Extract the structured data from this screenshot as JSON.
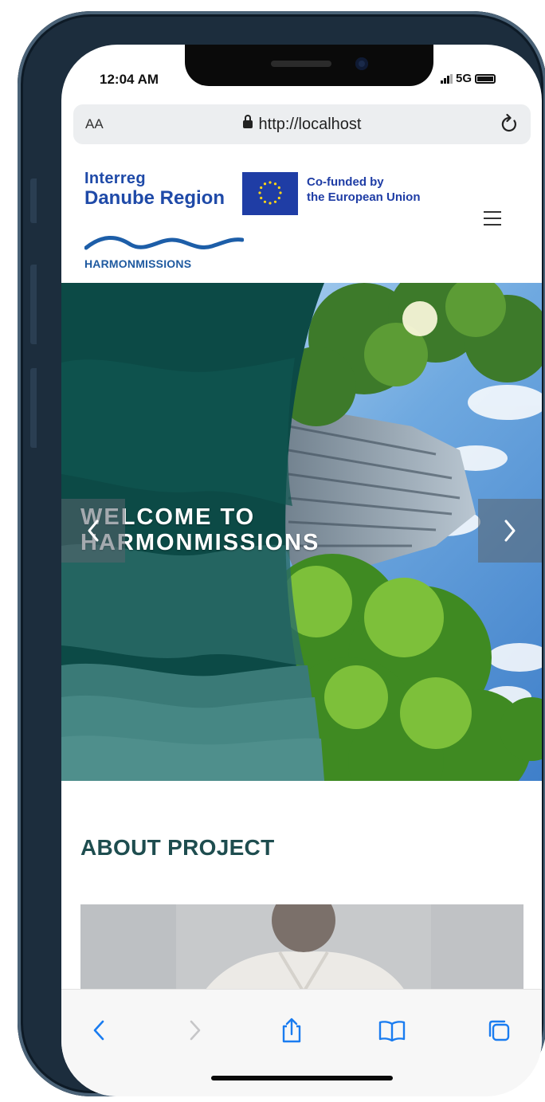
{
  "status_bar": {
    "time": "12:04 AM",
    "network": "5G"
  },
  "browser": {
    "text_size_label": "AA",
    "url": "http://localhost",
    "lock_icon": "lock-icon",
    "reload_icon": "reload-icon"
  },
  "site_header": {
    "interreg_line1": "Interreg",
    "interreg_line2": "Danube Region",
    "eu_line1": "Co-funded by",
    "eu_line2": "the European Union",
    "project_logo_text": "HARMONMISSIONS",
    "menu_icon": "hamburger-menu-icon"
  },
  "hero": {
    "title_line1": "WELCOME TO",
    "title_line2": "HARMONMISSIONS",
    "prev_icon": "chevron-left-icon",
    "next_icon": "chevron-right-icon"
  },
  "about": {
    "title": "ABOUT PROJECT"
  },
  "toolbar": {
    "icons": [
      "back-icon",
      "forward-icon",
      "share-icon",
      "bookmarks-icon",
      "tabs-icon"
    ]
  },
  "colors": {
    "brand_blue": "#1f4aa8",
    "eu_blue": "#1f3da5",
    "teal_dark": "#0c4a46",
    "heading_teal": "#1e4d4f",
    "ios_blue": "#1a7cf0"
  }
}
